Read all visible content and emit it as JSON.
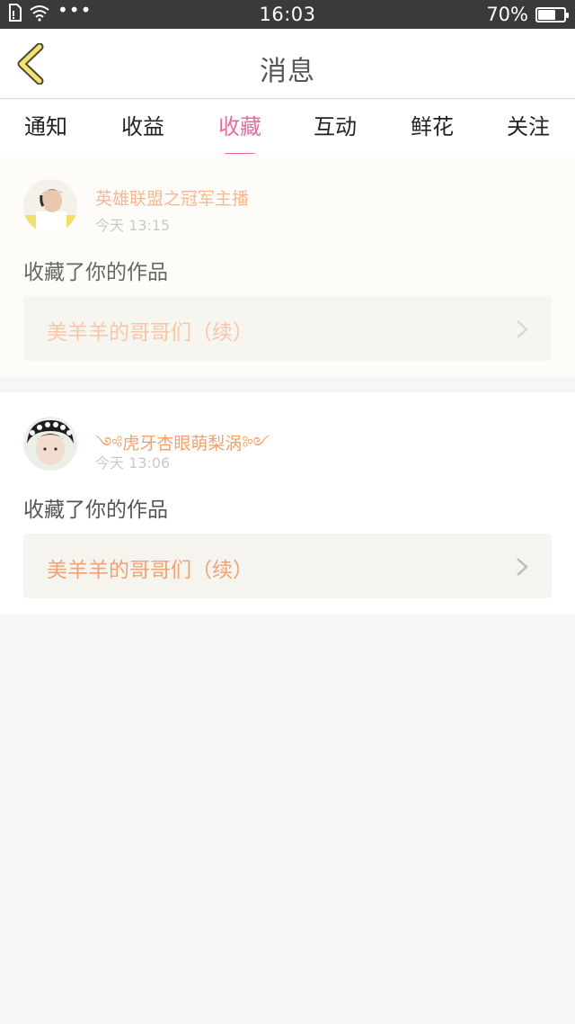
{
  "status_bar": {
    "time": "16:03",
    "battery_percent": "70%",
    "battery_level": 0.7,
    "icons": [
      "sim-icon",
      "wifi-icon",
      "more-dots-icon"
    ],
    "dots": "•••"
  },
  "navbar": {
    "title": "消息",
    "back_icon": "chevron-left-icon"
  },
  "tabs": [
    {
      "label": "通知",
      "active": false
    },
    {
      "label": "收益",
      "active": false
    },
    {
      "label": "收藏",
      "active": true
    },
    {
      "label": "互动",
      "active": false
    },
    {
      "label": "鲜花",
      "active": false
    },
    {
      "label": "关注",
      "active": false
    }
  ],
  "colors": {
    "accent": "#e76ba0",
    "username": "#f2a16b",
    "work_title": "#f0a374",
    "card_link_bg": "#f5f4ef"
  },
  "messages": [
    {
      "username": "英雄联盟之冠军主播",
      "time": "今天 13:15",
      "action": "收藏了你的作品",
      "work_title": "美羊羊的哥哥们（续）"
    },
    {
      "username": "༺虎牙杏眼萌梨涡༻",
      "time": "今天 13:06",
      "action": "收藏了你的作品",
      "work_title": "美羊羊的哥哥们（续）"
    }
  ]
}
